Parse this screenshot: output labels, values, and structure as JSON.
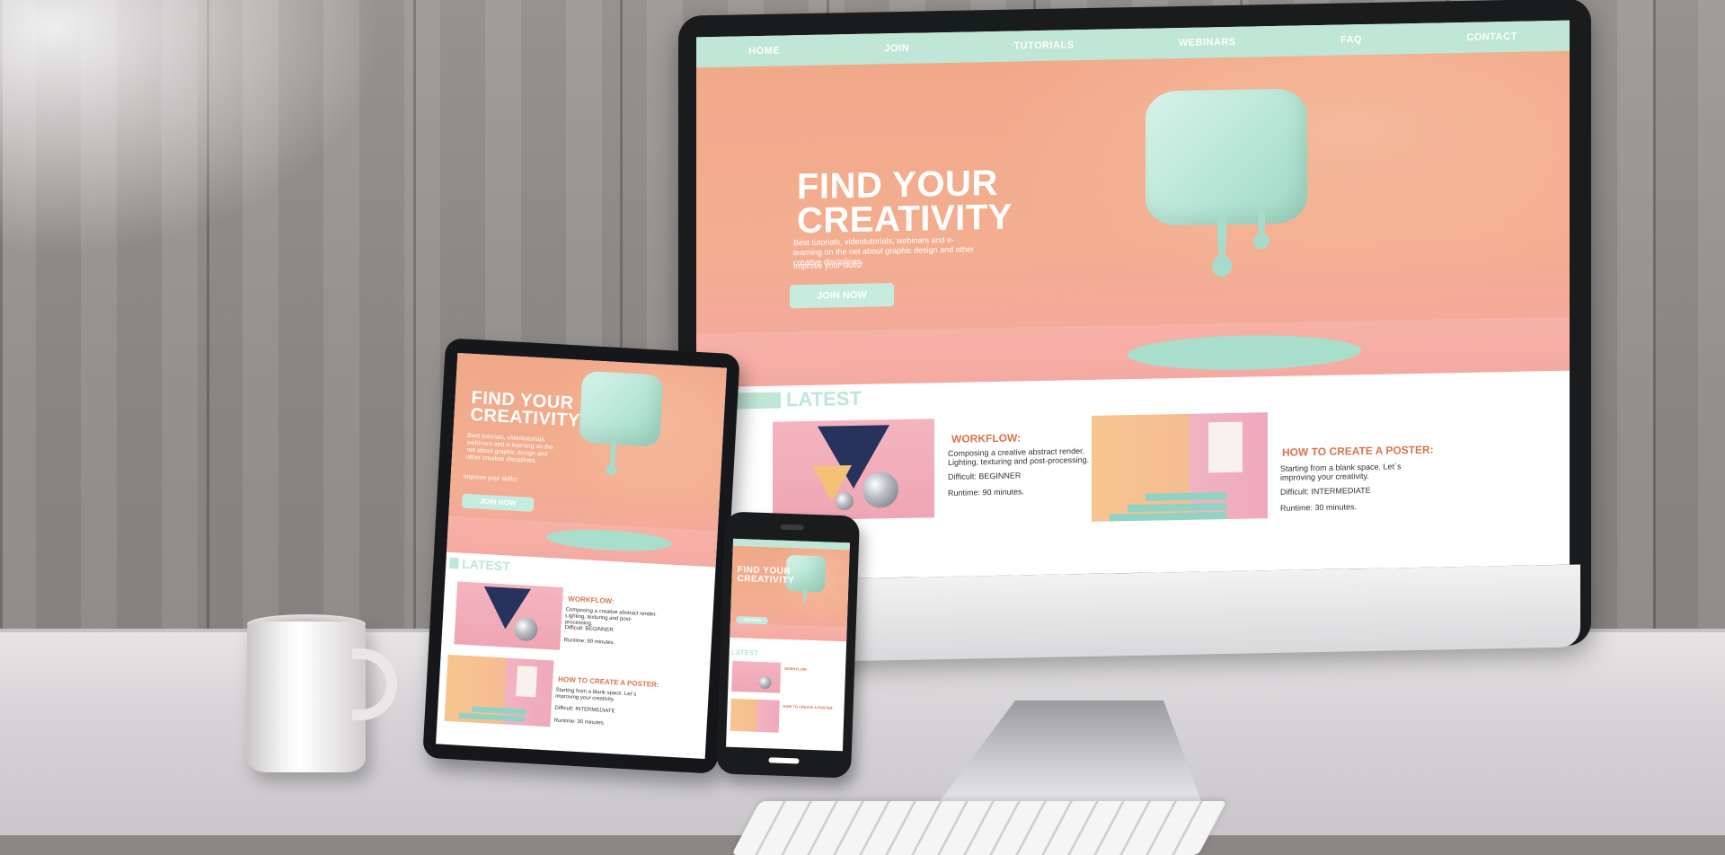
{
  "site": {
    "nav": [
      "HOME",
      "JOIN",
      "TUTORIALS",
      "WEBINARS",
      "FAQ",
      "CONTACT"
    ],
    "hero": {
      "title_line1": "FIND YOUR",
      "title_line2": "CREATIVITY",
      "description": "Best tutorials, videotutorials, webinars and e-learning on the net about graphic design and other creative disciplines.",
      "tagline": "Improve your skills!",
      "cta": "JOIN NOW"
    },
    "latest": {
      "heading": "LATEST",
      "articles": [
        {
          "title": "WORKFLOW:",
          "description": "Composing a creative abstract render. Lighting, texturing and post-processing.",
          "difficulty": "Difficult: BEGINNER",
          "runtime": "Runtime: 90 minutes."
        },
        {
          "title": "HOW TO CREATE A POSTER:",
          "description": "Starting from a blank space. Let´s improving your creativity.",
          "difficulty": "Difficult: INTERMEDIATE",
          "runtime": "Runtime: 30 minutes."
        }
      ]
    }
  },
  "colors": {
    "accent_mint": "#bfe6d6",
    "hero_peach": "#f3ae90",
    "article_title_orange": "#d9744a"
  },
  "icons": {
    "monitor": "desktop-monitor-icon",
    "tablet": "tablet-device-icon",
    "phone": "smartphone-icon",
    "mug": "coffee-mug-icon"
  }
}
